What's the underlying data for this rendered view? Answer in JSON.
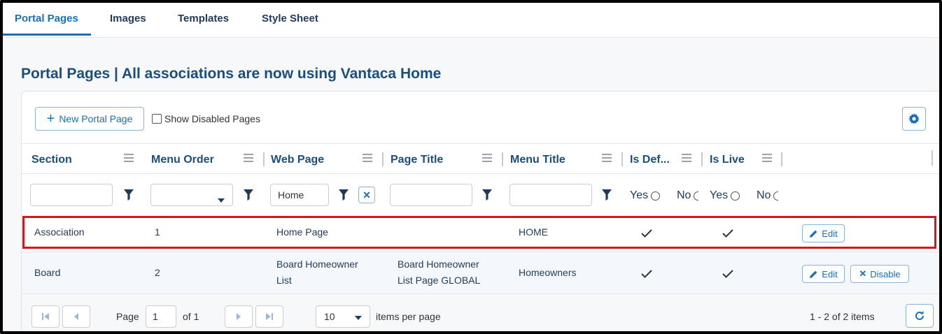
{
  "tabs": [
    {
      "label": "Portal Pages",
      "active": true
    },
    {
      "label": "Images"
    },
    {
      "label": "Templates"
    },
    {
      "label": "Style Sheet"
    }
  ],
  "page_title": "Portal Pages | All associations are now using Vantaca Home",
  "toolbar": {
    "new_button_label": "New Portal Page",
    "show_disabled_label": "Show Disabled Pages",
    "show_disabled_checked": false
  },
  "columns": [
    {
      "label": "Section"
    },
    {
      "label": "Menu Order"
    },
    {
      "label": "Web Page"
    },
    {
      "label": "Page Title"
    },
    {
      "label": "Menu Title"
    },
    {
      "label": "Is Def..."
    },
    {
      "label": "Is Live"
    }
  ],
  "filters": {
    "section": "",
    "menu_order": "",
    "web_page": "Home",
    "page_title": "",
    "menu_title": "",
    "is_default_yes": "Yes",
    "is_default_no": "No",
    "is_live_yes": "Yes",
    "is_live_no": "No"
  },
  "rows": [
    {
      "section": "Association",
      "menu_order": "1",
      "web_page_line1": "Home Page",
      "web_page_line2": "",
      "page_title_line1": "",
      "page_title_line2": "",
      "menu_title": "HOME",
      "is_default": true,
      "is_live": true,
      "actions": [
        "Edit"
      ]
    },
    {
      "section": "Board",
      "menu_order": "2",
      "web_page_line1": "Board Homeowner",
      "web_page_line2": "List",
      "page_title_line1": "Board Homeowner",
      "page_title_line2": "List Page GLOBAL",
      "menu_title": "Homeowners",
      "is_default": true,
      "is_live": true,
      "actions": [
        "Edit",
        "Disable"
      ]
    }
  ],
  "pager": {
    "page_label": "Page",
    "page_value": "1",
    "of_label": "of 1",
    "page_size": "10",
    "items_per_page_label": "items per page",
    "summary": "1 - 2 of 2 items"
  },
  "colors": {
    "accent": "#1a6fb8",
    "header_text": "#1a4e7e",
    "highlight": "#d6161d"
  }
}
